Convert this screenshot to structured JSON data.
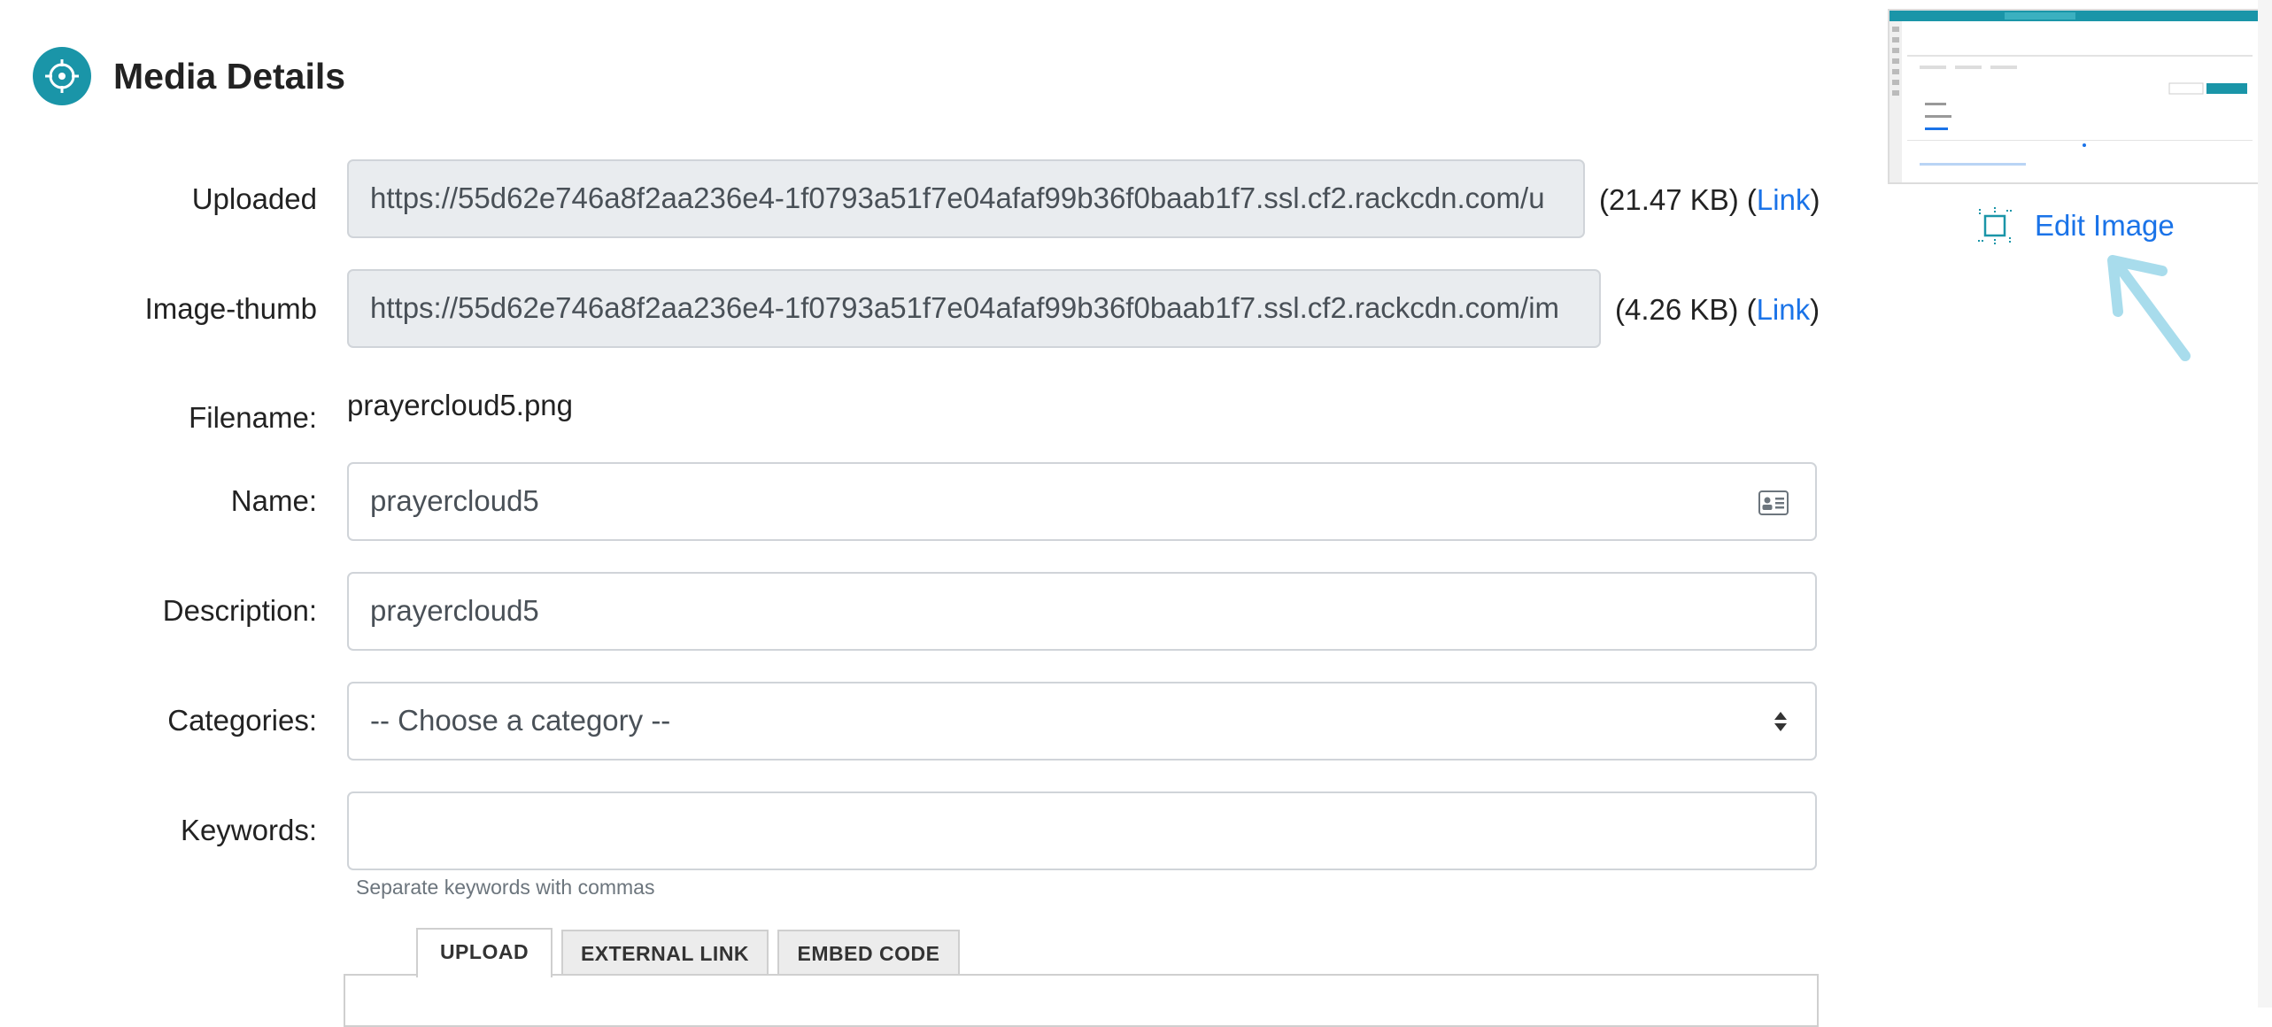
{
  "header": {
    "title": "Media Details",
    "icon": "crosshair-icon",
    "icon_color": "#1a95a8"
  },
  "form": {
    "uploaded": {
      "label": "Uploaded",
      "value": "https://55d62e746a8f2aa236e4-1f0793a51f7e04afaf99b36f0baab1f7.ssl.cf2.rackcdn.com/u",
      "size": "(21.47 KB)",
      "link": "Link"
    },
    "image_thumb": {
      "label": "Image-thumb",
      "value": "https://55d62e746a8f2aa236e4-1f0793a51f7e04afaf99b36f0baab1f7.ssl.cf2.rackcdn.com/im",
      "size": "(4.26 KB)",
      "link": "Link"
    },
    "filename": {
      "label": "Filename:",
      "value": "prayercloud5.png"
    },
    "name": {
      "label": "Name:",
      "value": "prayercloud5",
      "icon": "contact-card-icon"
    },
    "description": {
      "label": "Description:",
      "value": "prayercloud5"
    },
    "categories": {
      "label": "Categories:",
      "selected": "-- Choose a category --"
    },
    "keywords": {
      "label": "Keywords:",
      "value": "",
      "help": "Separate keywords with commas"
    }
  },
  "tabs": [
    {
      "label": "UPLOAD",
      "active": true
    },
    {
      "label": "EXTERNAL LINK",
      "active": false
    },
    {
      "label": "EMBED CODE",
      "active": false
    }
  ],
  "preview": {
    "edit_label": "Edit Image",
    "edit_icon": "crop-icon",
    "hint_icon": "arrow-up-left-icon",
    "accent_color": "#1a73e8"
  }
}
